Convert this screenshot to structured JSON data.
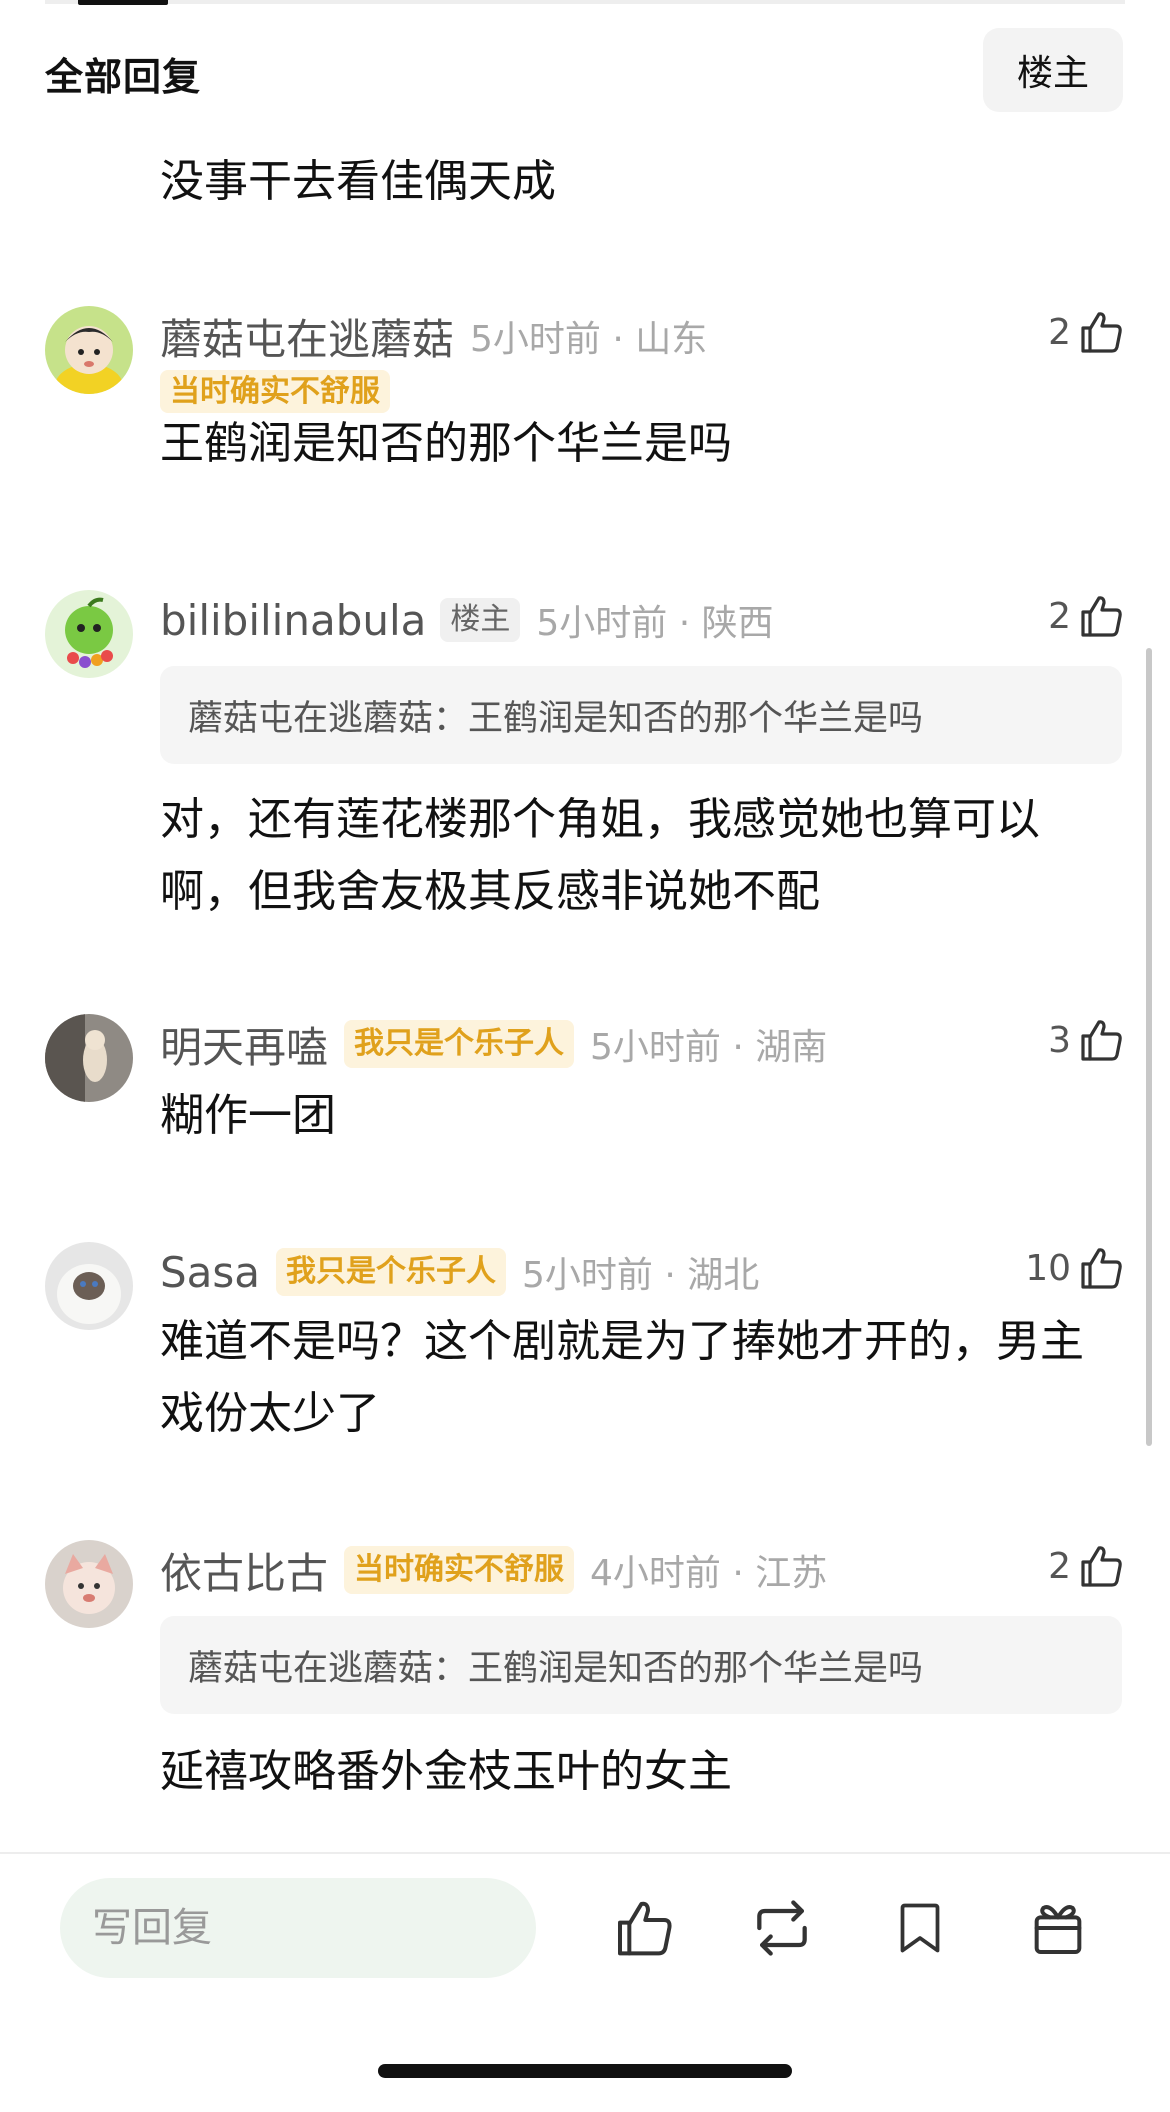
{
  "header": {
    "title": "全部回复",
    "louzhu_button": "楼主"
  },
  "top_comment": {
    "text": "没事干去看佳偶天成"
  },
  "comments": [
    {
      "username": "蘑菇屯在逃蘑菇",
      "tag": "当时确实不舒服",
      "time": "5小时前 · 山东",
      "likes": "2",
      "text": "王鹤润是知否的那个华兰是吗"
    },
    {
      "username": "bilibilinabula",
      "badge": "楼主",
      "time": "5小时前 · 陕西",
      "likes": "2",
      "quote": "蘑菇屯在逃蘑菇：王鹤润是知否的那个华兰是吗",
      "text": "对，还有莲花楼那个角姐，我感觉她也算可以啊，但我舍友极其反感非说她不配"
    },
    {
      "username": "明天再嗑",
      "tag": "我只是个乐子人",
      "time": "5小时前 · 湖南",
      "likes": "3",
      "text": "糊作一团"
    },
    {
      "username": "Sasa",
      "tag": "我只是个乐子人",
      "time": "5小时前 · 湖北",
      "likes": "10",
      "text": "难道不是吗？这个剧就是为了捧她才开的，男主戏份太少了"
    },
    {
      "username": "依古比古",
      "tag": "当时确实不舒服",
      "time": "4小时前 · 江苏",
      "likes": "2",
      "quote": "蘑菇屯在逃蘑菇：王鹤润是知否的那个华兰是吗",
      "text": "延禧攻略番外金枝玉叶的女主"
    }
  ],
  "bottom_bar": {
    "reply_placeholder": "写回复",
    "icons": [
      "thumbs-up-icon",
      "repost-icon",
      "bookmark-icon",
      "gift-icon"
    ]
  },
  "colors": {
    "tag_bg": "#fdf3dc",
    "tag_text": "#e0a11c",
    "quote_bg": "#f5f5f5",
    "input_bg": "#eef5ef"
  }
}
